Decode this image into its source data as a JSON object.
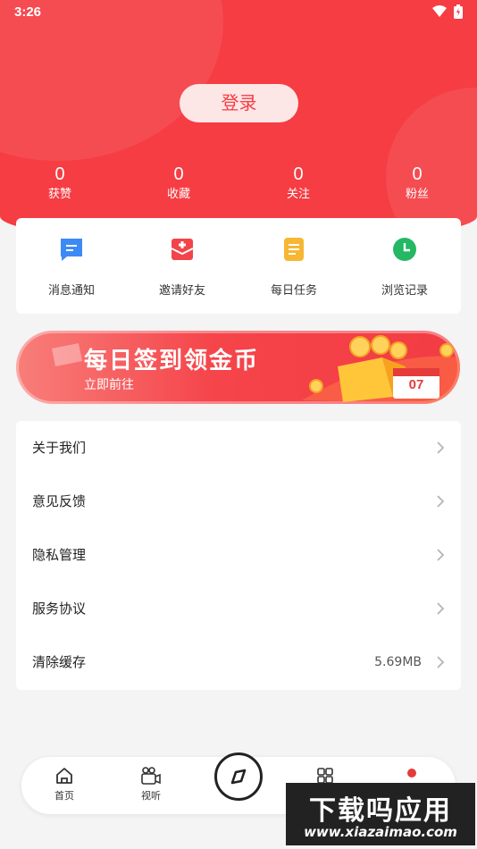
{
  "status_bar": {
    "time": "3:26"
  },
  "header": {
    "login_label": "登录"
  },
  "stats": [
    {
      "value": "0",
      "label": "获赞"
    },
    {
      "value": "0",
      "label": "收藏"
    },
    {
      "value": "0",
      "label": "关注"
    },
    {
      "value": "0",
      "label": "粉丝"
    }
  ],
  "quick_actions": [
    {
      "label": "消息通知",
      "icon": "message-icon",
      "color": "#3d8af7"
    },
    {
      "label": "邀请好友",
      "icon": "gift-icon",
      "color": "#f2444a"
    },
    {
      "label": "每日任务",
      "icon": "task-icon",
      "color": "#f7b733"
    },
    {
      "label": "浏览记录",
      "icon": "clock-icon",
      "color": "#25b864"
    }
  ],
  "banner": {
    "title": "每日签到领金币",
    "subtitle": "立即前往",
    "calendar_day": "07"
  },
  "menu": [
    {
      "label": "关于我们",
      "value": ""
    },
    {
      "label": "意见反馈",
      "value": ""
    },
    {
      "label": "隐私管理",
      "value": ""
    },
    {
      "label": "服务协议",
      "value": ""
    },
    {
      "label": "清除缓存",
      "value": "5.69MB"
    }
  ],
  "tabbar": [
    {
      "label": "首页",
      "icon": "home-icon"
    },
    {
      "label": "视听",
      "icon": "video-camera-icon"
    },
    {
      "label": "",
      "icon": "compass-icon"
    },
    {
      "label": "",
      "icon": "grid-icon"
    },
    {
      "label": "",
      "icon": "profile-dot-icon"
    }
  ],
  "watermark": {
    "title": "下载吗应用",
    "url": "www.xiazaimao.com"
  },
  "colors": {
    "primary": "#f53d43",
    "background": "#f4f4f4"
  }
}
